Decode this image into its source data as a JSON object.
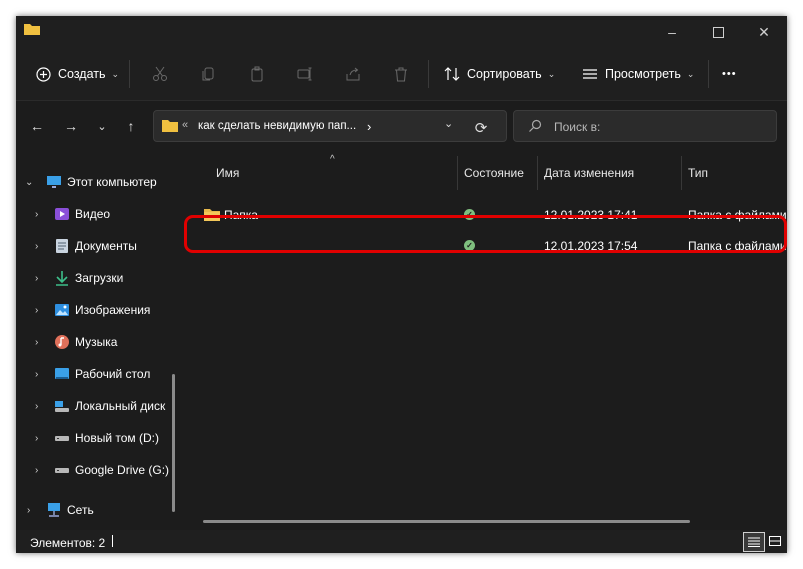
{
  "toolbar": {
    "create_label": "Создать",
    "sort_label": "Сортировать",
    "view_label": "Просмотреть",
    "more_label": "•••"
  },
  "address": {
    "path": "как сделать невидимую пап...",
    "prefix": "«",
    "next": "›"
  },
  "search": {
    "placeholder": "Поиск в:"
  },
  "sidebar": {
    "items": [
      {
        "label": "Этот компьютер",
        "icon": "monitor-icon"
      },
      {
        "label": "Видео",
        "icon": "video-icon"
      },
      {
        "label": "Документы",
        "icon": "documents-icon"
      },
      {
        "label": "Загрузки",
        "icon": "downloads-icon"
      },
      {
        "label": "Изображения",
        "icon": "images-icon"
      },
      {
        "label": "Музыка",
        "icon": "music-icon"
      },
      {
        "label": "Рабочий стол",
        "icon": "desktop-icon"
      },
      {
        "label": "Локальный диск",
        "icon": "drive-icon"
      },
      {
        "label": "Новый том (D:)",
        "icon": "drive-icon"
      },
      {
        "label": "Google Drive (G:)",
        "icon": "drive-icon"
      },
      {
        "label": "Сеть",
        "icon": "network-icon"
      }
    ]
  },
  "columns": {
    "name": "Имя",
    "status": "Состояние",
    "date": "Дата изменения",
    "type": "Тип"
  },
  "files": [
    {
      "name": "Папка",
      "status": "synced",
      "date": "12.01.2023 17:41",
      "type": "Папка с файлами"
    },
    {
      "name": "",
      "status": "synced",
      "date": "12.01.2023 17:54",
      "type": "Папка с файлами"
    }
  ],
  "statusbar": {
    "items_count": "Элементов: 2"
  },
  "colors": {
    "highlight": "#e00000",
    "folder": "#e8b84a",
    "status_ok": "#7fbf7f"
  }
}
